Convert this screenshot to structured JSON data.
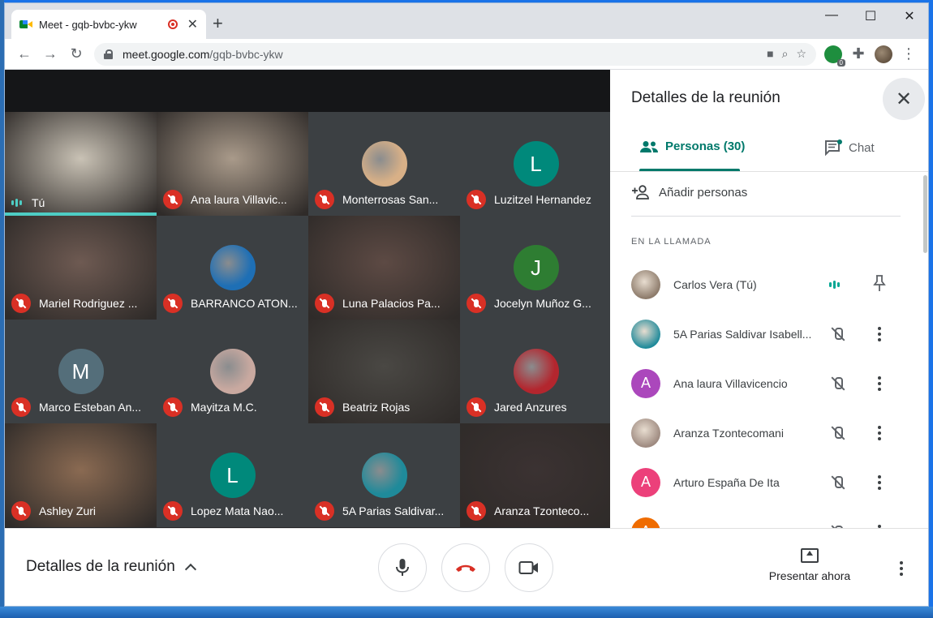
{
  "browser": {
    "tab_title": "Meet - gqb-bvbc-ykw",
    "url_host": "meet.google.com",
    "url_path": "/gqb-bvbc-ykw",
    "extension_badge": "0"
  },
  "tiles": [
    {
      "name": "Tú",
      "type": "photo",
      "muted": false,
      "photo_color": "#c9c2b5",
      "speaking": true
    },
    {
      "name": "Ana laura Villavic...",
      "type": "photo",
      "muted": true,
      "photo_color": "#a99a8a"
    },
    {
      "name": "Monterrosas San...",
      "type": "avatar-image",
      "muted": true,
      "avatar_color": "#d8b087"
    },
    {
      "name": "Luzitzel Hernandez",
      "type": "letter",
      "letter": "L",
      "muted": true,
      "avatar_color": "#00897b"
    },
    {
      "name": "Mariel Rodriguez ...",
      "type": "photo",
      "muted": true,
      "photo_color": "#6e5a52"
    },
    {
      "name": "BARRANCO ATON...",
      "type": "avatar-image",
      "muted": true,
      "avatar_color": "#1e6fb5"
    },
    {
      "name": "Luna Palacios Pa...",
      "type": "photo",
      "muted": true,
      "photo_color": "#5d4a44"
    },
    {
      "name": "Jocelyn Muñoz G...",
      "type": "letter",
      "letter": "J",
      "muted": true,
      "avatar_color": "#2e7d32"
    },
    {
      "name": "Marco Esteban An...",
      "type": "letter",
      "letter": "M",
      "muted": true,
      "avatar_color": "#546e7a"
    },
    {
      "name": "Mayitza M.C.",
      "type": "avatar-image",
      "muted": true,
      "avatar_color": "#c9a9a0"
    },
    {
      "name": "Beatriz Rojas",
      "type": "photo",
      "muted": true,
      "photo_color": "#4a4844"
    },
    {
      "name": "Jared Anzures",
      "type": "avatar-image",
      "muted": true,
      "avatar_color": "#b3262e"
    },
    {
      "name": "Ashley Zuri",
      "type": "photo",
      "muted": true,
      "photo_color": "#8a6a52"
    },
    {
      "name": "Lopez Mata Nao...",
      "type": "letter",
      "letter": "L",
      "muted": true,
      "avatar_color": "#00897b"
    },
    {
      "name": "5A Parias Saldivar...",
      "type": "avatar-image",
      "muted": true,
      "avatar_color": "#1f8a9a"
    },
    {
      "name": "Aranza Tzonteco...",
      "type": "photo",
      "muted": true,
      "photo_color": "#3b3232"
    }
  ],
  "bottombar": {
    "details_label": "Detalles de la reunión",
    "present_label": "Presentar ahora"
  },
  "panel": {
    "title": "Detalles de la reunión",
    "tab_people": "Personas (30)",
    "tab_chat": "Chat",
    "add_people": "Añadir personas",
    "section_label": "EN LA LLAMADA",
    "participants": [
      {
        "name": "Carlos Vera  (Tú)",
        "type": "photo",
        "color": "#8d7b6b",
        "self": true
      },
      {
        "name": "5A Parias Saldivar Isabell...",
        "type": "photo",
        "color": "#1f8a9a"
      },
      {
        "name": "Ana laura Villavicencio",
        "type": "letter",
        "letter": "A",
        "color": "#ab47bc"
      },
      {
        "name": "Aranza Tzontecomani",
        "type": "photo",
        "color": "#9e8a80"
      },
      {
        "name": "Arturo España De Ita",
        "type": "letter",
        "letter": "A",
        "color": "#ec407a"
      },
      {
        "name": "",
        "type": "letter",
        "letter": "A",
        "color": "#ef6c00"
      }
    ]
  }
}
